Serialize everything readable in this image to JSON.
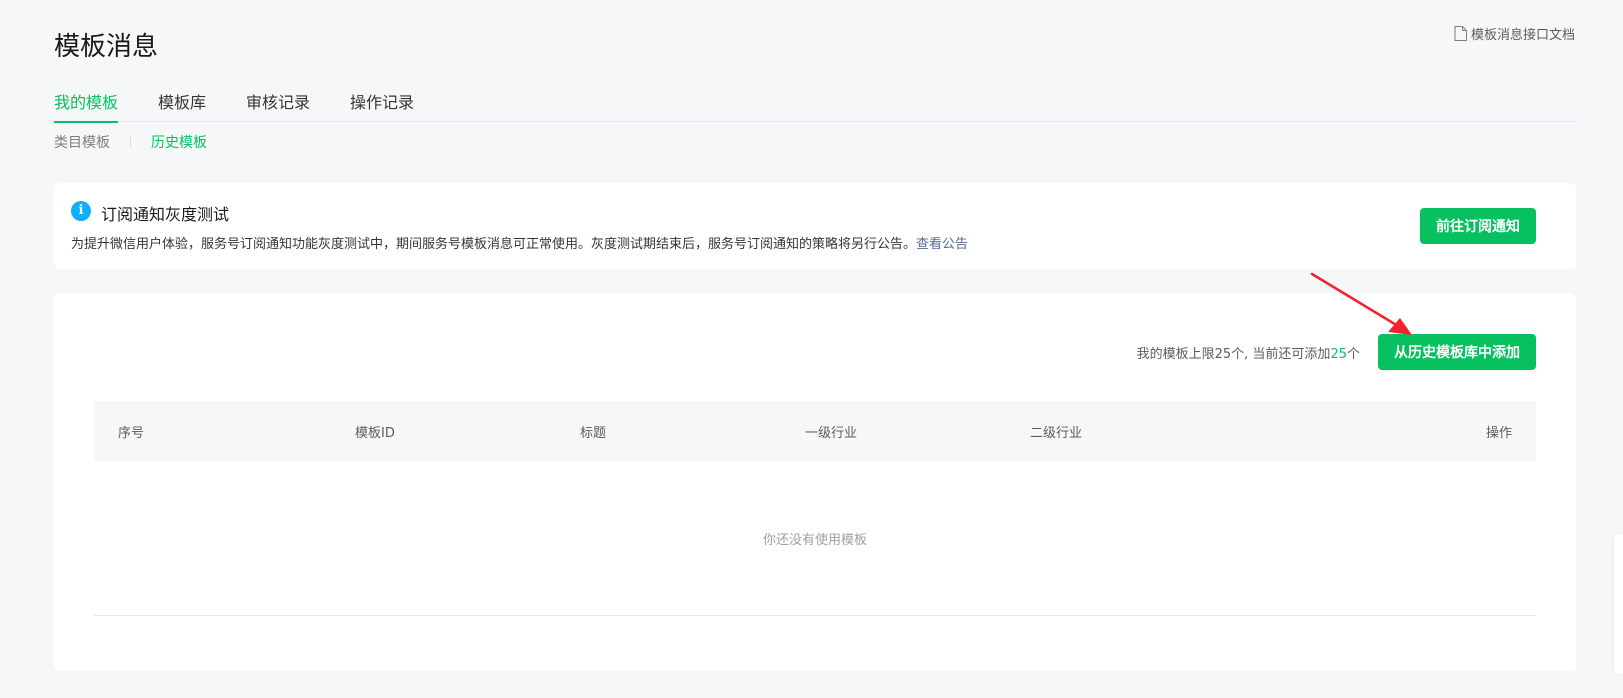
{
  "header": {
    "title": "模板消息",
    "doc_link": "模板消息接口文档",
    "doc_icon": "document-icon"
  },
  "tabs": [
    {
      "label": "我的模板",
      "active": true
    },
    {
      "label": "模板库",
      "active": false
    },
    {
      "label": "审核记录",
      "active": false
    },
    {
      "label": "操作记录",
      "active": false
    }
  ],
  "subtabs": [
    {
      "label": "类目模板",
      "active": false
    },
    {
      "label": "历史模板",
      "active": true
    }
  ],
  "notice": {
    "icon": "info-icon",
    "icon_glyph": "i",
    "title": "订阅通知灰度测试",
    "description": "为提升微信用户体验，服务号订阅通知功能灰度测试中，期间服务号模板消息可正常使用。灰度测试期结束后，服务号订阅通知的策略将另行公告。",
    "link": "查看公告",
    "button": "前往订阅通知"
  },
  "templates": {
    "limit_prefix": "我的模板上限25个, 当前还可添加",
    "limit_remaining": "25",
    "limit_suffix": "个",
    "add_button": "从历史模板库中添加",
    "columns": [
      "序号",
      "模板ID",
      "标题",
      "一级行业",
      "二级行业",
      "操作"
    ],
    "empty_text": "你还没有使用模板"
  },
  "colors": {
    "brand_green": "#07c160",
    "info_blue": "#10aeff",
    "link_blue": "#576b95",
    "arrow_red": "#f5222d"
  }
}
